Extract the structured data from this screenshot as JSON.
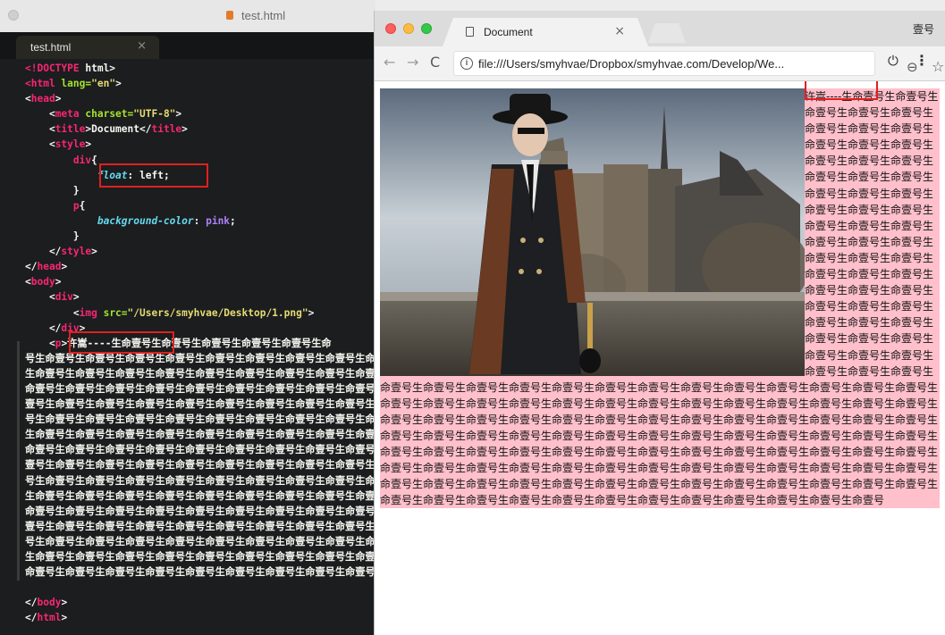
{
  "editor": {
    "window_title": "test.html",
    "tab_label": "test.html",
    "code_lines": [
      {
        "parts": [
          {
            "c": "tag",
            "t": "<!DOCTYPE "
          },
          {
            "c": "txt",
            "t": "html>"
          }
        ]
      },
      {
        "parts": [
          {
            "c": "tag",
            "t": "<html "
          },
          {
            "c": "attr",
            "t": "lang="
          },
          {
            "c": "str",
            "t": "\"en\""
          },
          {
            "c": "txt",
            "t": ">"
          }
        ]
      },
      {
        "parts": [
          {
            "c": "txt",
            "t": "<"
          },
          {
            "c": "tag",
            "t": "head"
          },
          {
            "c": "txt",
            "t": ">"
          }
        ]
      },
      {
        "parts": [
          {
            "c": "txt",
            "t": "    <"
          },
          {
            "c": "tag",
            "t": "meta "
          },
          {
            "c": "attr",
            "t": "charset="
          },
          {
            "c": "str",
            "t": "\"UTF-8\""
          },
          {
            "c": "txt",
            "t": ">"
          }
        ]
      },
      {
        "parts": [
          {
            "c": "txt",
            "t": "    <"
          },
          {
            "c": "tag",
            "t": "title"
          },
          {
            "c": "txt",
            "t": ">Document</"
          },
          {
            "c": "tag",
            "t": "title"
          },
          {
            "c": "txt",
            "t": ">"
          }
        ]
      },
      {
        "parts": [
          {
            "c": "txt",
            "t": "    <"
          },
          {
            "c": "tag",
            "t": "style"
          },
          {
            "c": "txt",
            "t": ">"
          }
        ]
      },
      {
        "parts": [
          {
            "c": "txt",
            "t": "        "
          },
          {
            "c": "tag",
            "t": "div"
          },
          {
            "c": "txt",
            "t": "{"
          }
        ]
      },
      {
        "parts": [
          {
            "c": "txt",
            "t": "            "
          },
          {
            "c": "prop",
            "t": "float"
          },
          {
            "c": "txt",
            "t": ": "
          },
          {
            "c": "txt",
            "t": "left;"
          }
        ]
      },
      {
        "parts": [
          {
            "c": "txt",
            "t": "        }"
          }
        ]
      },
      {
        "parts": [
          {
            "c": "txt",
            "t": "        "
          },
          {
            "c": "tag",
            "t": "p"
          },
          {
            "c": "txt",
            "t": "{"
          }
        ]
      },
      {
        "parts": [
          {
            "c": "txt",
            "t": "            "
          },
          {
            "c": "prop",
            "t": "background-color"
          },
          {
            "c": "txt",
            "t": ": "
          },
          {
            "c": "val",
            "t": "pink"
          },
          {
            "c": "txt",
            "t": ";"
          }
        ]
      },
      {
        "parts": [
          {
            "c": "txt",
            "t": "        }"
          }
        ]
      },
      {
        "parts": [
          {
            "c": "txt",
            "t": "    </"
          },
          {
            "c": "tag",
            "t": "style"
          },
          {
            "c": "txt",
            "t": ">"
          }
        ]
      },
      {
        "parts": [
          {
            "c": "txt",
            "t": "</"
          },
          {
            "c": "tag",
            "t": "head"
          },
          {
            "c": "txt",
            "t": ">"
          }
        ]
      },
      {
        "parts": [
          {
            "c": "txt",
            "t": "<"
          },
          {
            "c": "tag",
            "t": "body"
          },
          {
            "c": "txt",
            "t": ">"
          }
        ]
      },
      {
        "parts": [
          {
            "c": "txt",
            "t": "    <"
          },
          {
            "c": "tag",
            "t": "div"
          },
          {
            "c": "txt",
            "t": ">"
          }
        ]
      },
      {
        "parts": [
          {
            "c": "txt",
            "t": "        <"
          },
          {
            "c": "tag",
            "t": "img "
          },
          {
            "c": "attr",
            "t": "src="
          },
          {
            "c": "str",
            "t": "\"/Users/smyhvae/Desktop/1.png\""
          },
          {
            "c": "txt",
            "t": ">"
          }
        ]
      },
      {
        "parts": [
          {
            "c": "txt",
            "t": "    </"
          },
          {
            "c": "tag",
            "t": "div"
          },
          {
            "c": "txt",
            "t": ">"
          }
        ]
      },
      {
        "parts": [
          {
            "c": "txt",
            "t": "    <"
          },
          {
            "c": "tag",
            "t": "p"
          },
          {
            "c": "txt",
            "t": ">许嵩----生命壹号生命壹号生命壹号生命壹号生命壹号生命"
          }
        ]
      },
      {
        "parts": [
          {
            "c": "txt",
            "t": "号生命壹号生命壹号生命壹号生命壹号生命壹号生命壹号生命壹号生命壹号生命壹号"
          }
        ]
      },
      {
        "parts": [
          {
            "c": "txt",
            "t": "生命壹号生命壹号生命壹号生命壹号生命壹号生命壹号生命壹号生命壹号生命壹号生"
          }
        ]
      },
      {
        "parts": [
          {
            "c": "txt",
            "t": "命壹号生命壹号生命壹号生命壹号生命壹号生命壹号生命壹号生命壹号生命壹号生命"
          }
        ]
      },
      {
        "parts": [
          {
            "c": "txt",
            "t": "壹号生命壹号生命壹号生命壹号生命壹号生命壹号生命壹号生命壹号生命壹号生命壹"
          }
        ]
      },
      {
        "parts": [
          {
            "c": "txt",
            "t": "号生命壹号生命壹号生命壹号生命壹号生命壹号生命壹号生命壹号生命壹号生命壹号"
          }
        ]
      },
      {
        "parts": [
          {
            "c": "txt",
            "t": "生命壹号生命壹号生命壹号生命壹号生命壹号生命壹号生命壹号生命壹号生命壹号生"
          }
        ]
      },
      {
        "parts": [
          {
            "c": "txt",
            "t": "命壹号生命壹号生命壹号生命壹号生命壹号生命壹号生命壹号生命壹号生命壹号生命"
          }
        ]
      },
      {
        "parts": [
          {
            "c": "txt",
            "t": "壹号生命壹号生命壹号生命壹号生命壹号生命壹号生命壹号生命壹号生命壹号生命壹"
          }
        ]
      },
      {
        "parts": [
          {
            "c": "txt",
            "t": "号生命壹号生命壹号生命壹号生命壹号生命壹号生命壹号生命壹号生命壹号生命壹号"
          }
        ]
      },
      {
        "parts": [
          {
            "c": "txt",
            "t": "生命壹号生命壹号生命壹号生命壹号生命壹号生命壹号生命壹号生命壹号生命壹号生"
          }
        ]
      },
      {
        "parts": [
          {
            "c": "txt",
            "t": "命壹号生命壹号生命壹号生命壹号生命壹号生命壹号生命壹号生命壹号生命壹号生命"
          }
        ]
      },
      {
        "parts": [
          {
            "c": "txt",
            "t": "壹号生命壹号生命壹号生命壹号生命壹号生命壹号生命壹号生命壹号生命壹号生命壹"
          }
        ]
      },
      {
        "parts": [
          {
            "c": "txt",
            "t": "号生命壹号生命壹号生命壹号生命壹号生命壹号生命壹号生命壹号生命壹号生命壹号"
          }
        ]
      },
      {
        "parts": [
          {
            "c": "txt",
            "t": "生命壹号生命壹号生命壹号生命壹号生命壹号生命壹号生命壹号生命壹号生命壹号生"
          }
        ]
      },
      {
        "parts": [
          {
            "c": "txt",
            "t": "命壹号生命壹号生命壹号生命壹号生命壹号生命壹号生命壹号生命壹号生命壹号</"
          }
        ]
      },
      {
        "parts": [
          {
            "c": "txt",
            "t": ""
          }
        ]
      },
      {
        "parts": [
          {
            "c": "txt",
            "t": "</"
          },
          {
            "c": "tag",
            "t": "body"
          },
          {
            "c": "txt",
            "t": ">"
          }
        ]
      },
      {
        "parts": [
          {
            "c": "txt",
            "t": "</"
          },
          {
            "c": "tag",
            "t": "html"
          },
          {
            "c": "txt",
            "t": ">"
          }
        ]
      }
    ]
  },
  "browser": {
    "tab_title": "Document",
    "tab_close": "×",
    "profile_name": "壹号",
    "url": "file:///Users/smyhvae/Dropbox/smyhvae.com/Develop/We...",
    "icons": [
      "back-icon",
      "forward-icon",
      "reload-icon",
      "info-icon",
      "zoom-icon",
      "star-icon",
      "power-icon",
      "menu-icon",
      "document-icon"
    ],
    "page": {
      "paragraph_prefix": "许嵩----",
      "paragraph_unit": "生命壹号",
      "paragraph_repeat": 156
    }
  },
  "colors": {
    "editor_bg": "#1b1d1e",
    "paragraph_bg": "pink",
    "highlight_box": "#e02020"
  }
}
